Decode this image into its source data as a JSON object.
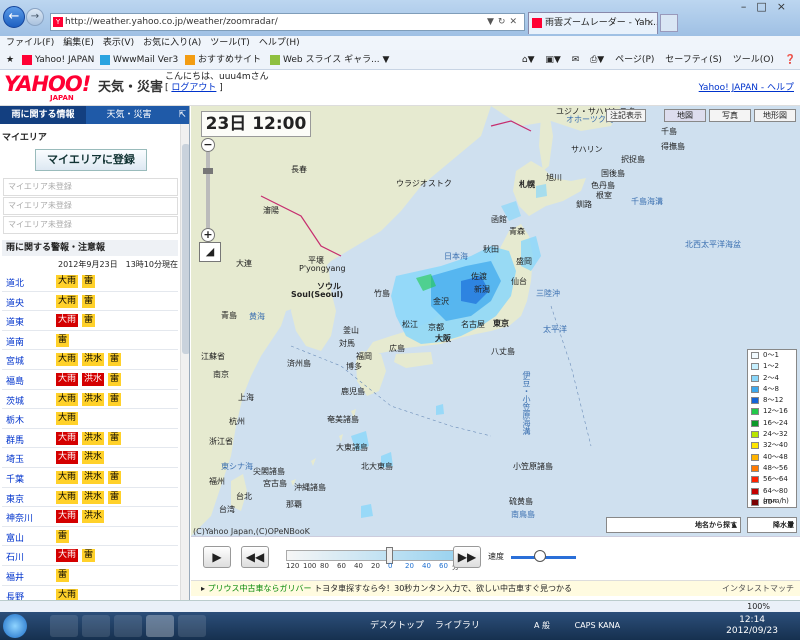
{
  "browser": {
    "url": "http://weather.yahoo.co.jp/weather/zoomradar/",
    "tab_title": "雨雲ズームレーダー - Yah...",
    "menu": [
      "ファイル(F)",
      "編集(E)",
      "表示(V)",
      "お気に入り(A)",
      "ツール(T)",
      "ヘルプ(H)"
    ],
    "favorites": [
      "Yahoo! JAPAN",
      "WwwMail Ver3",
      "おすすめサイト",
      "Web スライス ギャラ..."
    ],
    "tools": [
      "ページ(P)",
      "セーフティ(S)",
      "ツール(O)"
    ],
    "zoom": "100%"
  },
  "header": {
    "logo": "YAHOO!",
    "logo_sub": "JAPAN",
    "section": "天気・災害",
    "greeting": "こんにちは、",
    "username": "uuu4m",
    "greeting_suffix": "さん",
    "logout": "ログアウト",
    "logout_open": "[",
    "logout_close": "]",
    "right_links": "Yahoo! JAPAN - ヘルプ"
  },
  "sidebar": {
    "tab_active": "雨に関する情報",
    "tab_other": "天気・災害",
    "my_area_title": "マイエリア",
    "register_button": "マイエリアに登録",
    "slots": [
      "マイエリア未登録",
      "マイエリア未登録",
      "マイエリア未登録"
    ],
    "alerts_title": "雨に関する警報・注意報",
    "alerts_date": "2012年9月23日　13時10分現在",
    "alerts": [
      {
        "pref": "道北",
        "badges": [
          {
            "t": "大雨",
            "c": "yel"
          },
          {
            "t": "雷",
            "c": "yel"
          }
        ]
      },
      {
        "pref": "道央",
        "badges": [
          {
            "t": "大雨",
            "c": "yel"
          },
          {
            "t": "雷",
            "c": "yel"
          }
        ]
      },
      {
        "pref": "道東",
        "badges": [
          {
            "t": "大雨",
            "c": "red"
          },
          {
            "t": "雷",
            "c": "yel"
          }
        ]
      },
      {
        "pref": "道南",
        "badges": [
          {
            "t": "雷",
            "c": "yel"
          }
        ]
      },
      {
        "pref": "宮城",
        "badges": [
          {
            "t": "大雨",
            "c": "yel"
          },
          {
            "t": "洪水",
            "c": "yel"
          },
          {
            "t": "雷",
            "c": "yel"
          }
        ]
      },
      {
        "pref": "福島",
        "badges": [
          {
            "t": "大雨",
            "c": "red"
          },
          {
            "t": "洪水",
            "c": "red"
          },
          {
            "t": "雷",
            "c": "yel"
          }
        ]
      },
      {
        "pref": "茨城",
        "badges": [
          {
            "t": "大雨",
            "c": "yel"
          },
          {
            "t": "洪水",
            "c": "yel"
          },
          {
            "t": "雷",
            "c": "yel"
          }
        ]
      },
      {
        "pref": "栃木",
        "badges": [
          {
            "t": "大雨",
            "c": "yel"
          }
        ]
      },
      {
        "pref": "群馬",
        "badges": [
          {
            "t": "大雨",
            "c": "red"
          },
          {
            "t": "洪水",
            "c": "yel"
          },
          {
            "t": "雷",
            "c": "yel"
          }
        ]
      },
      {
        "pref": "埼玉",
        "badges": [
          {
            "t": "大雨",
            "c": "red"
          },
          {
            "t": "洪水",
            "c": "yel"
          }
        ]
      },
      {
        "pref": "千葉",
        "badges": [
          {
            "t": "大雨",
            "c": "yel"
          },
          {
            "t": "洪水",
            "c": "yel"
          },
          {
            "t": "雷",
            "c": "yel"
          }
        ]
      },
      {
        "pref": "東京",
        "badges": [
          {
            "t": "大雨",
            "c": "yel"
          },
          {
            "t": "洪水",
            "c": "yel"
          },
          {
            "t": "雷",
            "c": "yel"
          }
        ]
      },
      {
        "pref": "神奈川",
        "badges": [
          {
            "t": "大雨",
            "c": "red"
          },
          {
            "t": "洪水",
            "c": "yel"
          }
        ]
      },
      {
        "pref": "富山",
        "badges": [
          {
            "t": "雷",
            "c": "yel"
          }
        ]
      },
      {
        "pref": "石川",
        "badges": [
          {
            "t": "大雨",
            "c": "red"
          },
          {
            "t": "雷",
            "c": "yel"
          }
        ]
      },
      {
        "pref": "福井",
        "badges": [
          {
            "t": "雷",
            "c": "yel"
          }
        ]
      },
      {
        "pref": "長野",
        "badges": [
          {
            "t": "大雨",
            "c": "yel"
          }
        ]
      }
    ]
  },
  "map": {
    "datetime": "23日 12:00",
    "views": [
      "注記表示",
      "地図",
      "写真",
      "地形図"
    ],
    "legend": [
      {
        "label": "0〜1",
        "color": "#f2fbff"
      },
      {
        "label": "1〜2",
        "color": "#c6f0ff"
      },
      {
        "label": "2〜4",
        "color": "#8ad7fa"
      },
      {
        "label": "4〜8",
        "color": "#3ca7ec"
      },
      {
        "label": "8〜12",
        "color": "#1363d7"
      },
      {
        "label": "12〜16",
        "color": "#21c94a"
      },
      {
        "label": "16〜24",
        "color": "#0c9a2a"
      },
      {
        "label": "24〜32",
        "color": "#b9e500"
      },
      {
        "label": "32〜40",
        "color": "#ffe600"
      },
      {
        "label": "40〜48",
        "color": "#ffb300"
      },
      {
        "label": "48〜56",
        "color": "#ff7a00"
      },
      {
        "label": "56〜64",
        "color": "#ff2200"
      },
      {
        "label": "64〜80",
        "color": "#c40000"
      },
      {
        "label": "80〜",
        "color": "#7a0000"
      }
    ],
    "legend_unit": "(mm/h)",
    "place_search": "地名から探す",
    "rain_select": "降水量",
    "copyright": "(C)Yahoo Japan,(C)OPeNBooK",
    "labels": {
      "changchun": "長春",
      "vladivostok": "ウラジオストク",
      "sapporo": "札幌",
      "asahikawa": "旭川",
      "kushiro": "釧路",
      "nemuro": "根室",
      "shenyang": "瀋陽",
      "dalian": "大連",
      "pyongyang": "平壌",
      "pyongyang_en": "P'yongyang",
      "seoul": "ソウル",
      "seoul_en": "Soul(Seoul)",
      "busan": "釜山",
      "fukuoka": "福岡",
      "hiroshima": "広島",
      "osaka": "大阪",
      "nagoya": "名古屋",
      "tokyo": "東京",
      "kyoto": "京都",
      "sendai": "仙台",
      "niigata": "新潟",
      "akita": "秋田",
      "morioka": "盛岡",
      "aomori": "青森",
      "hakodate": "函館",
      "kanazawa": "金沢",
      "matsue": "松江",
      "shanghai": "上海",
      "hangzhou": "杭州",
      "fuzhou": "福州",
      "taipei": "台北",
      "naha": "那覇",
      "kagoshima": "鹿児島",
      "nanjing": "南京",
      "qingdao": "青島",
      "jeju": "済州島",
      "japan_sea": "日本海",
      "yellow_sea": "黄海",
      "east_china_sea": "東シナ海",
      "pacific": "太平洋",
      "nw_pacific": "北西太平洋海盆",
      "izu": "伊豆・小笠原海溝",
      "ogasawara": "小笠原諸島",
      "iwo": "硫黄島",
      "minamitorishima": "南鳥島",
      "okinawa": "沖縄諸島",
      "senkaku": "尖閣諸島",
      "daito": "大東諸島",
      "amami": "奄美諸島",
      "sakhalin": "サハリン",
      "kunashir": "国後島",
      "etorofu": "択捉島",
      "chishima": "千島",
      "sea_okhotsk": "オホーツク海",
      "jiangsu": "江蘇省",
      "zhejiang": "浙江省",
      "taiwan": "台湾",
      "yuzhno": "ユジノ・サハリンスク",
      "kita_daito": "北大東島",
      "tsushima": "対馬",
      "takeshima": "竹島",
      "hachijo": "八丈島",
      "uruppu": "得撫島",
      "shikotan": "色丹島",
      "hakata": "博多",
      "sanriku": "三陸沖",
      "sado": "佐渡",
      "kuril_trench": "千島海溝",
      "miyako": "宮古島"
    }
  },
  "player": {
    "ticks": [
      "120",
      "100",
      "80",
      "60",
      "40",
      "20",
      "0",
      "20",
      "40",
      "60"
    ],
    "tick_unit": "分",
    "speed_label": "速度"
  },
  "ad": {
    "text": "プリウス中古車ならガリバー",
    "subtext": "トヨタ車探すなら今！30秒カンタン入力で、欲しい中古車すぐ見つかる",
    "right": "インタレストマッチ"
  },
  "taskbar": {
    "desktop": "デスクトップ",
    "library": "ライブラリ",
    "ime": "A 般",
    "caps": "CAPS KANA",
    "time": "12:14",
    "date": "2012/09/23"
  }
}
